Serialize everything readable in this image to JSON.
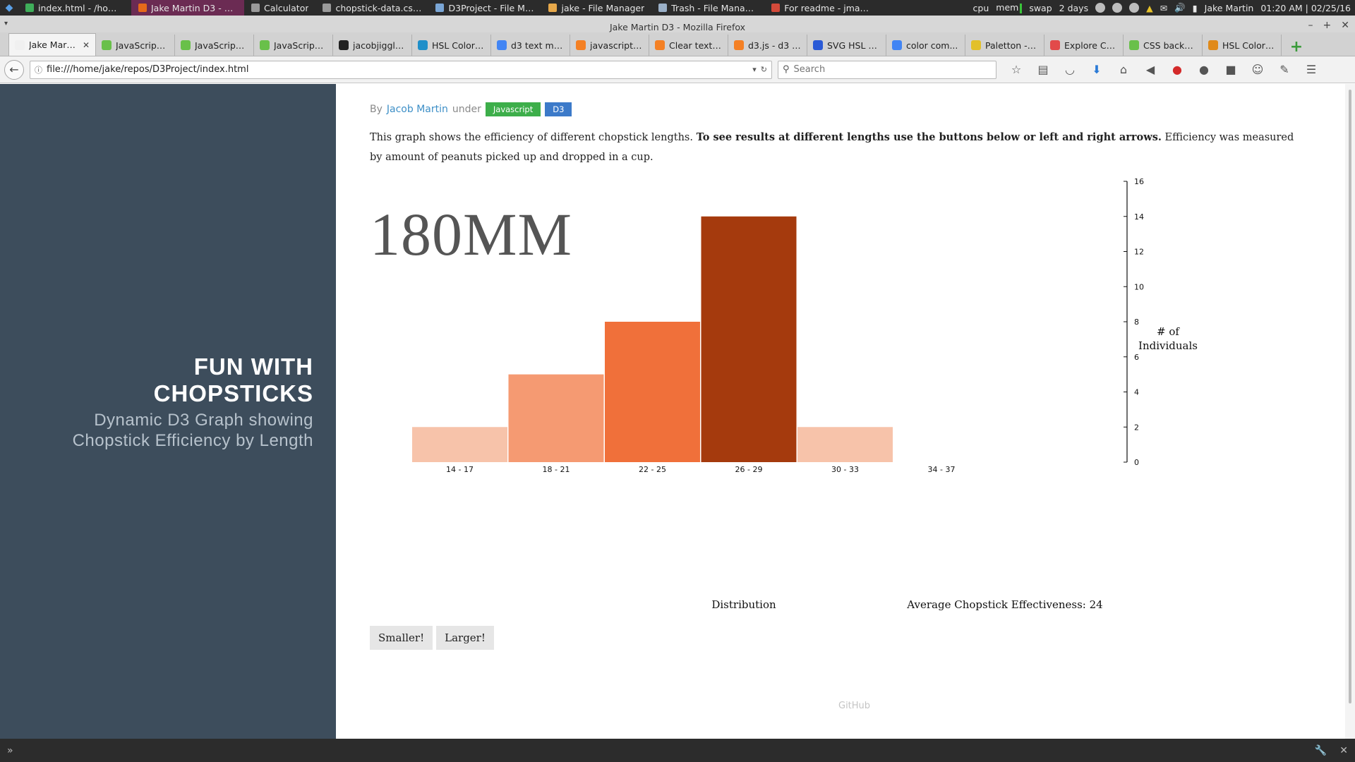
{
  "taskbar": {
    "windows": [
      {
        "label": "index.html - /home...",
        "color": "#3fae5a"
      },
      {
        "label": "Jake Martin D3 - M...",
        "color": "#e66a1a",
        "active": true
      },
      {
        "label": "Calculator",
        "color": "#9a9a9a"
      },
      {
        "label": "chopstick-data.csv ...",
        "color": "#9a9a9a"
      },
      {
        "label": "D3Project - File Ma...",
        "color": "#7aa6d6"
      },
      {
        "label": "jake - File Manager",
        "color": "#e6a84a"
      },
      {
        "label": "Trash - File Manager",
        "color": "#9ab0c8"
      },
      {
        "label": "For readme - jmart...",
        "color": "#d44a3a"
      }
    ],
    "cpu": "cpu",
    "mem": "mem",
    "swap": "swap",
    "uptime": "2 days",
    "user": "Jake Martin",
    "clock": "01:20 AM | 02/25/16"
  },
  "browser": {
    "window_title": "Jake Martin D3 - Mozilla Firefox",
    "tabs": [
      {
        "title": "Jake Martin...",
        "active": true,
        "fav": "#f0f0f0"
      },
      {
        "title": "JavaScript ...",
        "fav": "#69c04a"
      },
      {
        "title": "JavaScript ...",
        "fav": "#69c04a"
      },
      {
        "title": "JavaScript ...",
        "fav": "#69c04a"
      },
      {
        "title": "jacobjiggle...",
        "fav": "#222222"
      },
      {
        "title": "HSL Colors...",
        "fav": "#1f8fc9"
      },
      {
        "title": "d3 text mi...",
        "fav": "#4285f4"
      },
      {
        "title": "javascript -...",
        "fav": "#f48024"
      },
      {
        "title": "Clear text i...",
        "fav": "#f48024"
      },
      {
        "title": "d3.js - d3 l...",
        "fav": "#f48024"
      },
      {
        "title": "SVG HSL C...",
        "fav": "#2a5ad6"
      },
      {
        "title": "color com...",
        "fav": "#4285f4"
      },
      {
        "title": "Paletton - ...",
        "fav": "#e2c02a"
      },
      {
        "title": "Explore Co...",
        "fav": "#e24a4a"
      },
      {
        "title": "CSS backg...",
        "fav": "#69c04a"
      },
      {
        "title": "HSL Color ...",
        "fav": "#e08a1a"
      }
    ],
    "url": "file:///home/jake/repos/D3Project/index.html",
    "search_placeholder": "Search"
  },
  "sidebar": {
    "title_line1": "FUN WITH",
    "title_line2": "CHOPSTICKS",
    "subtitle_line1": "Dynamic D3 Graph showing",
    "subtitle_line2": "Chopstick Efficiency by Length"
  },
  "article": {
    "by": "By",
    "author": "Jacob Martin",
    "under": "under",
    "tags": [
      "Javascript",
      "D3"
    ],
    "desc_plain_1": "This graph shows the efficiency of different chopstick lengths.",
    "desc_bold": "To see results at different lengths use the buttons below or left and right arrows.",
    "desc_plain_2": "Efficiency was measured by amount of peanuts picked up and dropped in a cup.",
    "current_length": "180MM",
    "buttons": {
      "smaller": "Smaller!",
      "larger": "Larger!"
    },
    "footer_link": "GitHub"
  },
  "chart_data": {
    "type": "bar",
    "categories": [
      "14 - 17",
      "18 - 21",
      "22 - 25",
      "26 - 29",
      "30 - 33",
      "34 - 37"
    ],
    "values": [
      2,
      5,
      8,
      14,
      2,
      0
    ],
    "colors": [
      "#f7c3aa",
      "#f59a72",
      "#f0703a",
      "#a53a0d",
      "#f7c3aa",
      "#f7c3aa"
    ],
    "ylim": [
      0,
      16
    ],
    "yticks": [
      0,
      2,
      4,
      6,
      8,
      10,
      12,
      14,
      16
    ],
    "ylabel_line1": "# of",
    "ylabel_line2": "Individuals",
    "xlabel": "Distribution",
    "avg_label": "Average Chopstick Effectiveness: 24",
    "grid": false
  }
}
